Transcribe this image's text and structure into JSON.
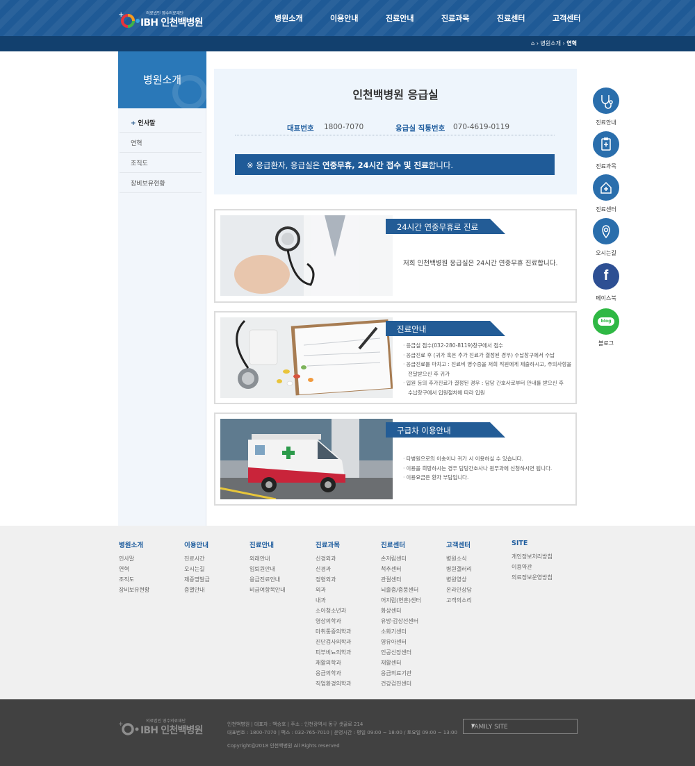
{
  "header": {
    "logo_sub": "의료법인 영수의료재단",
    "logo_name": "인천백병원",
    "nav": [
      "병원소개",
      "이용안내",
      "진료안내",
      "진료과목",
      "진료센터",
      "고객센터"
    ]
  },
  "location": {
    "current1": "병원소개",
    "current2": "연혁"
  },
  "lnb": {
    "title": "병원소개",
    "items": [
      "인사말",
      "연혁",
      "조직도",
      "장비보유현황"
    ]
  },
  "info": {
    "title": "인천백병원 응급실",
    "tel_label": "대표번호",
    "tel": "1800-7070",
    "er_label": "응급실 직통번호",
    "er": "070-4619-0119",
    "notice_pre": "※ 응급환자, 응급실은 ",
    "notice_bold": "연중무휴, 24시간 접수 및 진료",
    "notice_post": "합니다."
  },
  "cards": [
    {
      "title": "24시간 연중무휴로 진료",
      "text": "저희 인천백병원 응급실은 24시간 연중무휴 진료합니다."
    },
    {
      "title": "진료안내",
      "items": [
        "응급실 접수(032-280-8119)창구에서 접수",
        "응급진료 후 (귀가 혹은 추가 진료가 결정된 경우) 수납창구에서 수납",
        "응급진료를 마치고 : 진료비 영수증을 저희 직원에게 제출하시고, 주의사항을",
        "전달받으신 후 귀가",
        "입원 등의 추가진료가 결정된 경우 : 담당 간호사로부터 안내를 받으신 후",
        "수납창구에서 입원절차에 따라 입원"
      ]
    },
    {
      "title": "구급차 이용안내",
      "items": [
        "타병원으로의 이송이나 귀가 시 이용하실 수 있습니다.",
        "이용을 희망하시는 경우 담당간호사나 원무과에 신청하시면 됩니다.",
        "이용요금은 환자 부담입니다."
      ]
    }
  ],
  "quick": [
    "진료안내",
    "진료과목",
    "진료센터",
    "오시는길",
    "페이스북",
    "블로그"
  ],
  "quick_icons": [
    "stethoscope-icon",
    "clipboard-icon",
    "hospital-icon",
    "map-pin-icon",
    "facebook-icon",
    "blog-icon"
  ],
  "quick_glyphs": {
    "facebook": "f",
    "blog": "blog"
  },
  "sitemap": [
    {
      "head": "병원소개",
      "items": [
        "인사말",
        "연혁",
        "조직도",
        "장비보유현황"
      ]
    },
    {
      "head": "이용안내",
      "items": [
        "진료시간",
        "오시는길",
        "제증명발급",
        "증별안내"
      ]
    },
    {
      "head": "진료안내",
      "items": [
        "외래안내",
        "입퇴원안내",
        "응급진료안내",
        "비급여항목안내"
      ]
    },
    {
      "head": "진료과목",
      "items": [
        "신경외과",
        "신경과",
        "정형외과",
        "외과",
        "내과",
        "소아청소년과",
        "영상의학과",
        "마취통증의학과",
        "진단검사의학과",
        "피부비뇨의학과",
        "재활의학과",
        "응급의학과",
        "직업환경의학과"
      ]
    },
    {
      "head": "진료센터",
      "items": [
        "손저림센터",
        "척추센터",
        "관절센터",
        "뇌졸중/중풍센터",
        "어지럼(현훈)센터",
        "화상센터",
        "유방·갑상선센터",
        "소화기센터",
        "영유아센터",
        "인공신장센터",
        "재활센터",
        "응급의료기관",
        "건강검진센터"
      ]
    },
    {
      "head": "고객센터",
      "items": [
        "병원소식",
        "병원갤러리",
        "병원영상",
        "온라인상담",
        "고객의소리"
      ]
    },
    {
      "head": "SITE",
      "items": [
        "개인정보처리방침",
        "이용약관",
        "의료정보운영방침"
      ]
    }
  ],
  "footer": {
    "logo_sub": "의료법인 영수의료재단",
    "logo_name": "인천백병원",
    "line1": "인천백병원 | 대표자 : 백승호 | 주소 : 인천광역시 동구 샛골로 214",
    "line2": "대표번호 : 1800-7070 | 팩스 : 032-765-7010 | 운영시간 : 평일 09:00 ~ 18:00 / 토요일 09:00 ~ 13:00",
    "copyright": "Copyright@2018 인천백병원 All Rights reserved",
    "family_site": "FAMILY SITE"
  },
  "colors": {
    "brand": "#1f5a96",
    "accent": "#235c96",
    "lnb_head": "#2a78b8"
  }
}
